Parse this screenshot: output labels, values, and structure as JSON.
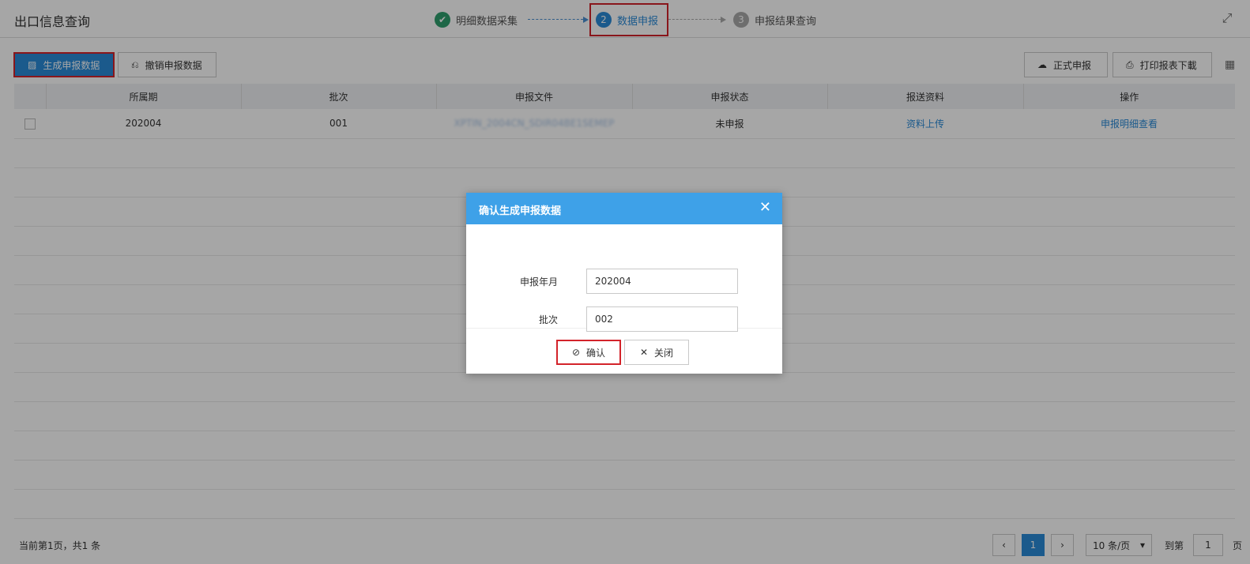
{
  "header": {
    "title": "出口信息查询",
    "steps": [
      {
        "num": "✔",
        "label": "明细数据采集",
        "state": "done"
      },
      {
        "num": "2",
        "label": "数据申报",
        "state": "active"
      },
      {
        "num": "3",
        "label": "申报结果查询",
        "state": "pending"
      }
    ],
    "expand_icon": "fullscreen-icon"
  },
  "toolbar": {
    "generate_label": "生成申报数据",
    "revoke_label": "撤销申报数据",
    "formal_label": "正式申报",
    "print_label": "打印报表下載"
  },
  "table": {
    "columns": [
      "",
      "所属期",
      "批次",
      "申报文件",
      "申报状态",
      "报送资料",
      "操作"
    ],
    "rows": [
      {
        "period": "202004",
        "batch": "001",
        "file": "XPTIN_2004CN_SDIR04BE1SEMEP",
        "status": "未申报",
        "upload": "资料上传",
        "action": "申报明细查看"
      }
    ]
  },
  "pager": {
    "info": "当前第1页，共1 条",
    "current": "1",
    "page_size": "10 条/页",
    "goto_label": "到第",
    "goto_value": "1",
    "page_unit": "页"
  },
  "dialog": {
    "title": "确认生成申报数据",
    "fields": [
      {
        "label": "申报年月",
        "value": "202004"
      },
      {
        "label": "批次",
        "value": "002"
      }
    ],
    "ok_label": "确认",
    "close_label": "关闭"
  },
  "colors": {
    "primary": "#2a8ad7",
    "dialog_header": "#3ea1e8",
    "highlight": "#d3232a",
    "done": "#2e9e6d"
  }
}
